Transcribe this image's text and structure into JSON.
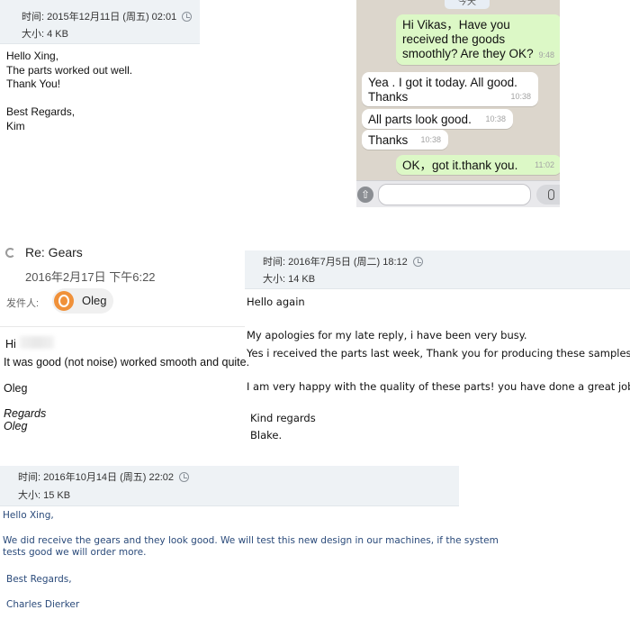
{
  "email1": {
    "time_label": "时间: 2015年12月11日 (周五) 02:01",
    "size_label": "大小: 4 KB",
    "body_lines": [
      "Hello Xing,",
      "The parts worked out well.",
      "Thank You!",
      "",
      "Best Regards,",
      "Kim"
    ]
  },
  "chat": {
    "date_chip": "今天",
    "messages": [
      {
        "direction": "out",
        "text": "Hi Vikas，Have you received the goods smoothly?  Are they OK?",
        "time": "9:48"
      },
      {
        "direction": "in",
        "text": "Yea . I got it today.  All good. Thanks",
        "time": "10:38"
      },
      {
        "direction": "in",
        "text": "All parts look good.",
        "time": "10:38"
      },
      {
        "direction": "in",
        "text": "Thanks",
        "time": "10:38"
      },
      {
        "direction": "out",
        "text": "OK，got it.thank you.",
        "time": "11:02"
      }
    ],
    "colors": {
      "outgoing": "#dcf8c6",
      "incoming": "#ffffff",
      "background": "#dcd6cc"
    }
  },
  "email2": {
    "subject": "Re: Gears",
    "date": "2016年2月17日 下午6:22",
    "from_label": "发件人:",
    "sender": "Oleg",
    "avatar_color": "#f0913a",
    "greeting": "Hi",
    "line1": "It was good (not noise) worked smooth and quite.",
    "line2": "Oleg",
    "regards": "Regards",
    "signature": "Oleg"
  },
  "email3": {
    "time_label": "时间: 2016年7月5日 (周二) 18:12",
    "size_label": "大小: 14 KB",
    "greeting": "Hello again",
    "line1": "My apologies for my late reply, i have been very busy.",
    "line2": "Yes i received the parts last week, Thank you for producing these samples so quickly",
    "line3": "I am very happy with the quality of these parts! you have done a great job, thank you",
    "regards": "Kind regards",
    "signature": "Blake."
  },
  "email4": {
    "time_label": "时间: 2016年10月14日 (周五) 22:02",
    "size_label": "大小: 15 KB",
    "greeting": "Hello Xing,",
    "line1": "We did receive the gears and they look good.  We will test this new design in our machines, if the system",
    "line2": "tests good we will order more.",
    "regards": "Best Regards,",
    "signature": "Charles Dierker"
  }
}
